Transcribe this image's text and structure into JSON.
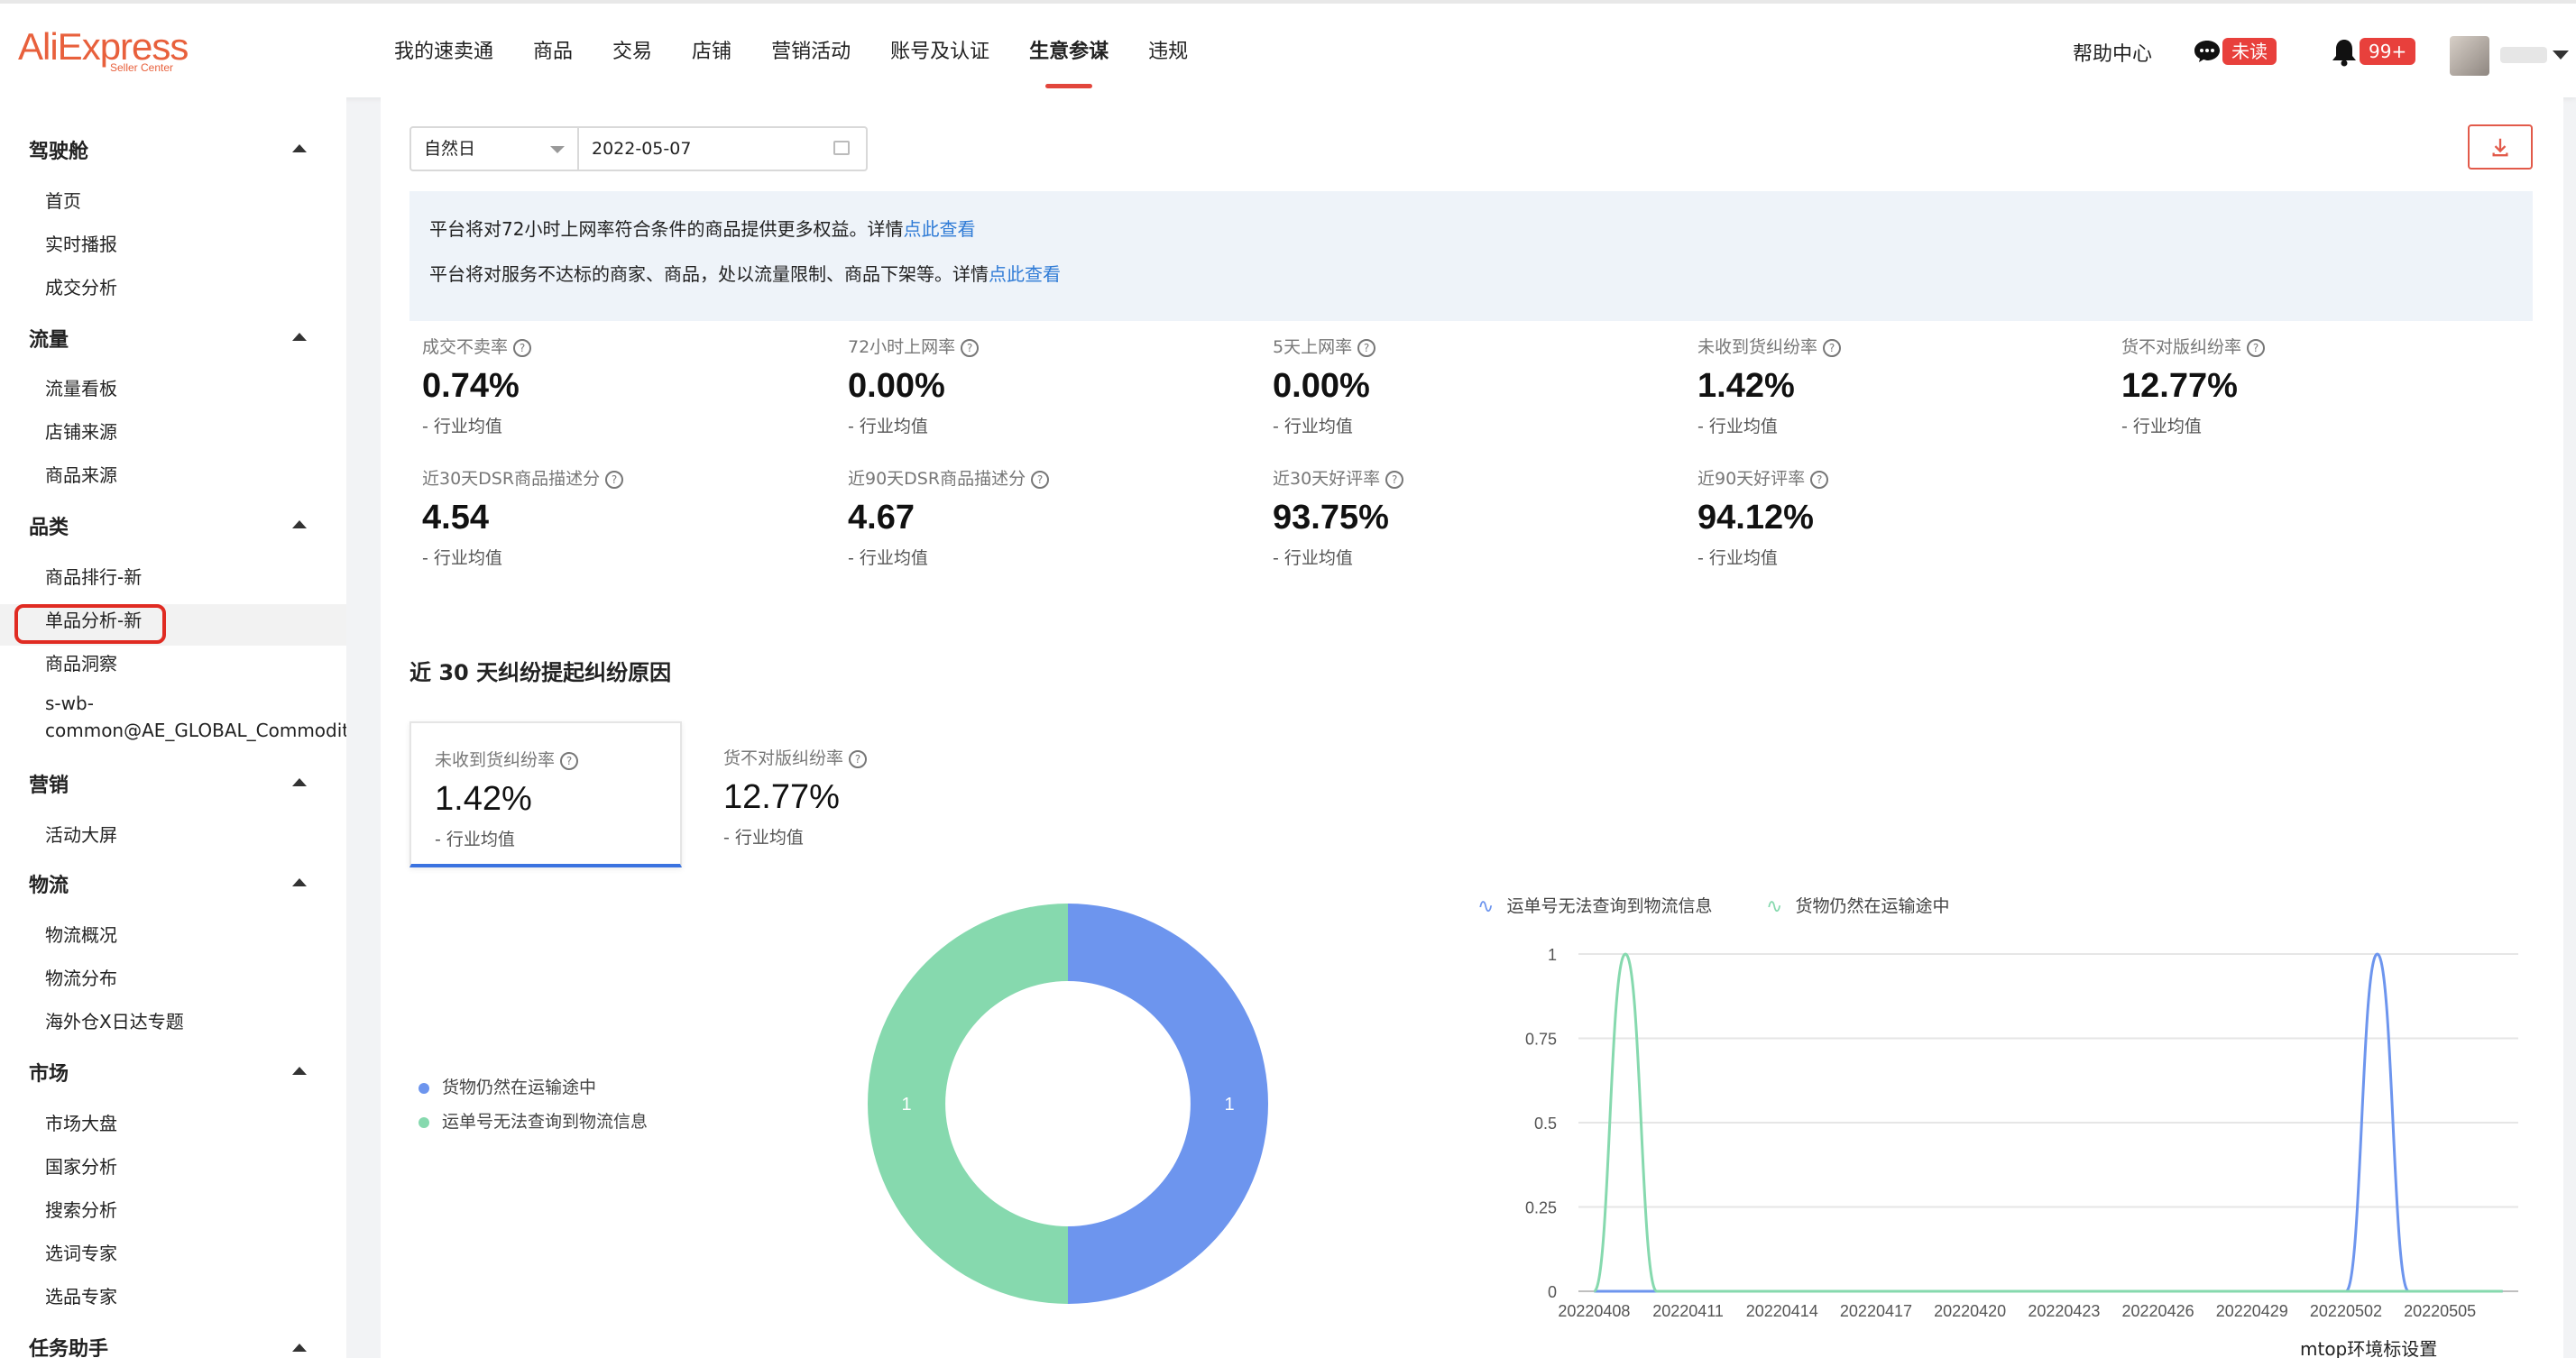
{
  "brand": {
    "name": "AliExpress",
    "sub": "Seller Center"
  },
  "nav": [
    "我的速卖通",
    "商品",
    "交易",
    "店铺",
    "营销活动",
    "账号及认证",
    "生意参谋",
    "违规"
  ],
  "header": {
    "help": "帮助中心",
    "unread_badge": "未读",
    "notif_badge": "99+"
  },
  "sidebar": {
    "groups": [
      {
        "title": "驾驶舱",
        "items": [
          "首页",
          "实时播报",
          "成交分析"
        ]
      },
      {
        "title": "流量",
        "items": [
          "流量看板",
          "店铺来源",
          "商品来源"
        ]
      },
      {
        "title": "品类",
        "items": [
          "商品排行-新",
          "单品分析-新",
          "商品洞察",
          "s-wb-",
          "common@AE_GLOBAL_Commodity"
        ]
      },
      {
        "title": "营销",
        "items": [
          "活动大屏"
        ]
      },
      {
        "title": "物流",
        "items": [
          "物流概况",
          "物流分布",
          "海外仓X日达专题"
        ]
      },
      {
        "title": "市场",
        "items": [
          "市场大盘",
          "国家分析",
          "搜索分析",
          "选词专家",
          "选品专家"
        ]
      },
      {
        "title": "任务助手",
        "items": []
      }
    ]
  },
  "filters": {
    "period": "自然日",
    "date": "2022-05-07"
  },
  "notice": {
    "line1": "平台将对72小时上网率符合条件的商品提供更多权益。详情",
    "line2": "平台将对服务不达标的商家、商品，处以流量限制、商品下架等。详情",
    "link": "点此查看"
  },
  "metrics": [
    {
      "label": "成交不卖率",
      "value": "0.74%",
      "sub": "- 行业均值"
    },
    {
      "label": "72小时上网率",
      "value": "0.00%",
      "sub": "- 行业均值"
    },
    {
      "label": "5天上网率",
      "value": "0.00%",
      "sub": "- 行业均值"
    },
    {
      "label": "未收到货纠纷率",
      "value": "1.42%",
      "sub": "- 行业均值"
    },
    {
      "label": "货不对版纠纷率",
      "value": "12.77%",
      "sub": "- 行业均值"
    },
    {
      "label": "近30天DSR商品描述分",
      "value": "4.54",
      "sub": "- 行业均值"
    },
    {
      "label": "近90天DSR商品描述分",
      "value": "4.67",
      "sub": "- 行业均值"
    },
    {
      "label": "近30天好评率",
      "value": "93.75%",
      "sub": "- 行业均值"
    },
    {
      "label": "近90天好评率",
      "value": "94.12%",
      "sub": "- 行业均值"
    }
  ],
  "dispute": {
    "title": "近 30 天纠纷提起纠纷原因",
    "tabs": [
      {
        "label": "未收到货纠纷率",
        "value": "1.42%",
        "sub": "- 行业均值"
      },
      {
        "label": "货不对版纠纷率",
        "value": "12.77%",
        "sub": "- 行业均值"
      }
    ]
  },
  "colors": {
    "blue": "#6d95ee",
    "green": "#86d9ae",
    "accent": "#e2463c",
    "link": "#2f7bd6"
  },
  "chart_data": [
    {
      "type": "pie",
      "series": [
        {
          "name": "货物仍然在运输途中",
          "value": 1,
          "color": "#6d95ee"
        },
        {
          "name": "运单号无法查询到物流信息",
          "value": 1,
          "color": "#86d9ae"
        }
      ],
      "legend_position": "left"
    },
    {
      "type": "line",
      "x": [
        "20220408",
        "20220409",
        "20220410",
        "20220411",
        "20220412",
        "20220413",
        "20220414",
        "20220415",
        "20220416",
        "20220417",
        "20220418",
        "20220419",
        "20220420",
        "20220421",
        "20220422",
        "20220423",
        "20220424",
        "20220425",
        "20220426",
        "20220427",
        "20220428",
        "20220429",
        "20220430",
        "20220501",
        "20220502",
        "20220503",
        "20220504",
        "20220505",
        "20220506",
        "20220507"
      ],
      "x_ticks": [
        "20220408",
        "20220411",
        "20220414",
        "20220417",
        "20220420",
        "20220423",
        "20220426",
        "20220429",
        "20220502",
        "20220505"
      ],
      "y_ticks": [
        "0",
        "0.25",
        "0.5",
        "0.75",
        "1"
      ],
      "ylim": [
        0,
        1
      ],
      "series": [
        {
          "name": "运单号无法查询到物流信息",
          "color": "#6d95ee",
          "values": [
            0,
            0,
            0,
            0,
            0,
            0,
            0,
            0,
            0,
            0,
            0,
            0,
            0,
            0,
            0,
            0,
            0,
            0,
            0,
            0,
            0,
            0,
            0,
            0,
            0,
            1,
            0,
            0,
            0,
            0
          ]
        },
        {
          "name": "货物仍然在运输途中",
          "color": "#86d9ae",
          "values": [
            0,
            1,
            0,
            0,
            0,
            0,
            0,
            0,
            0,
            0,
            0,
            0,
            0,
            0,
            0,
            0,
            0,
            0,
            0,
            0,
            0,
            0,
            0,
            0,
            0,
            0,
            0,
            0,
            0,
            0
          ]
        }
      ],
      "grid": true,
      "legend_position": "top-left"
    }
  ],
  "footer": {
    "env": "mtop环境标设置"
  }
}
